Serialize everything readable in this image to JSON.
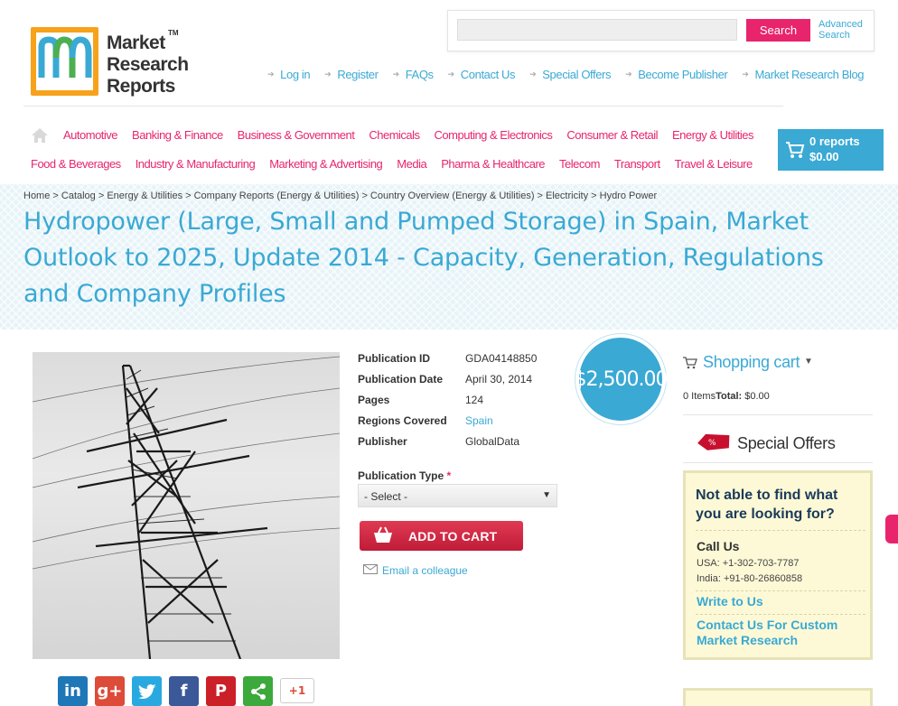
{
  "header": {
    "logo_lines": [
      "Market",
      "Research",
      "Reports"
    ],
    "logo_tm": "TM",
    "search_placeholder": "",
    "search_button": "Search",
    "advanced_search": "Advanced Search",
    "top_links": [
      "Log in",
      "Register",
      "FAQs",
      "Contact Us",
      "Special Offers",
      "Become Publisher",
      "Market Research Blog"
    ]
  },
  "nav": {
    "row1": [
      "Automotive",
      "Banking & Finance",
      "Business & Government",
      "Chemicals",
      "Computing & Electronics",
      "Consumer & Retail",
      "Energy & Utilities"
    ],
    "row2": [
      "Food & Beverages",
      "Industry & Manufacturing",
      "Marketing & Advertising",
      "Media",
      "Pharma & Healthcare",
      "Telecom",
      "Transport",
      "Travel & Leisure"
    ],
    "cart_reports": "0 reports",
    "cart_total": "$0.00"
  },
  "banner": {
    "breadcrumb": "Home > Catalog > Energy & Utilities > Company Reports (Energy & Utilities) > Country Overview (Energy & Utilities) > Electricity > Hydro Power",
    "title": "Hydropower (Large, Small and Pumped Storage) in Spain, Market Outlook to 2025, Update 2014 - Capacity, Generation, Regulations and Company Profiles"
  },
  "product": {
    "details": [
      {
        "label": "Publication ID",
        "value": "GDA04148850"
      },
      {
        "label": "Publication Date",
        "value": "April 30, 2014"
      },
      {
        "label": "Pages",
        "value": "124"
      },
      {
        "label": "Regions Covered",
        "value": "Spain"
      },
      {
        "label": "Publisher",
        "value": "GlobalData"
      }
    ],
    "price": "$2,500.00",
    "publication_type_label": "Publication Type",
    "required_mark": "*",
    "select_value": "- Select -",
    "add_to_cart": "ADD TO CART",
    "email_colleague": "Email a colleague",
    "plus_one": "+1"
  },
  "sidebar": {
    "cart_title": "Shopping cart",
    "items": "0 Items",
    "total_label": "Total:",
    "total_value": "$0.00",
    "special_offers": "Special Offers",
    "help_question": "Not able to find what you are looking for?",
    "call_us": "Call Us",
    "phone_usa": "USA: +1-302-703-7787",
    "phone_india": "India: +91-80-26860858",
    "write_to_us": "Write to Us",
    "contact_custom": "Contact Us For Custom Market Research"
  },
  "colors": {
    "accent_blue": "#3aa9d4",
    "accent_pink": "#e8256c",
    "logo_orange": "#f7a21b"
  }
}
